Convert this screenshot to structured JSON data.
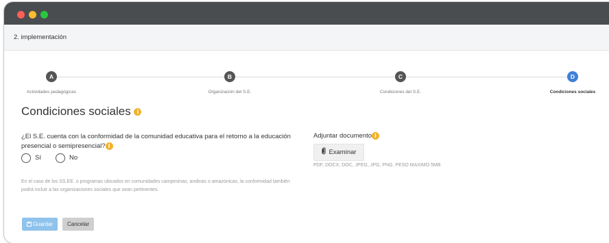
{
  "window": {
    "controls": [
      "close",
      "minimize",
      "maximize"
    ]
  },
  "header": {
    "title": "2. implementación"
  },
  "stepper": {
    "steps": [
      {
        "letter": "A",
        "label": "Actividades pedagógicas",
        "state": "done"
      },
      {
        "letter": "B",
        "label": "Organización del S.E.",
        "state": "done"
      },
      {
        "letter": "C",
        "label": "Condiciones del S.E.",
        "state": "done"
      },
      {
        "letter": "D",
        "label": "Condiciones sociales",
        "state": "active"
      }
    ]
  },
  "section": {
    "title": "Condiciones sociales",
    "info_icon": "i"
  },
  "question": {
    "text": "¿El S.E. cuenta con la conformidad de la comunidad educativa para el retorno a la educación presencial o semipresencial?",
    "info_icon": "i",
    "options": [
      "Sí",
      "No"
    ],
    "selected": null
  },
  "note": "En el caso de los SS.EE. o programas ubicados en comunidades campesinas, andinas o amazónicas, la conformidad también podrá incluir a las organizaciones sociales que sean pertinentes.",
  "attachment": {
    "label": "Adjuntar documento",
    "info_icon": "i",
    "button_label": "Examinar",
    "button_icon": "paperclip-icon",
    "formats": "PDF, DOCX, DOC, JPEG, JPG, PNG. PESO MAXIMO 5MB"
  },
  "actions": {
    "save_label": "Guardar",
    "save_icon": "floppy-disk-icon",
    "cancel_label": "Cancelar"
  },
  "colors": {
    "titlebar": "#4a4d50",
    "step_done": "#555555",
    "step_active": "#3f7fd6",
    "info": "#f1b22b",
    "save_button": "#8fc3ec",
    "cancel_button": "#cfcfcf"
  }
}
